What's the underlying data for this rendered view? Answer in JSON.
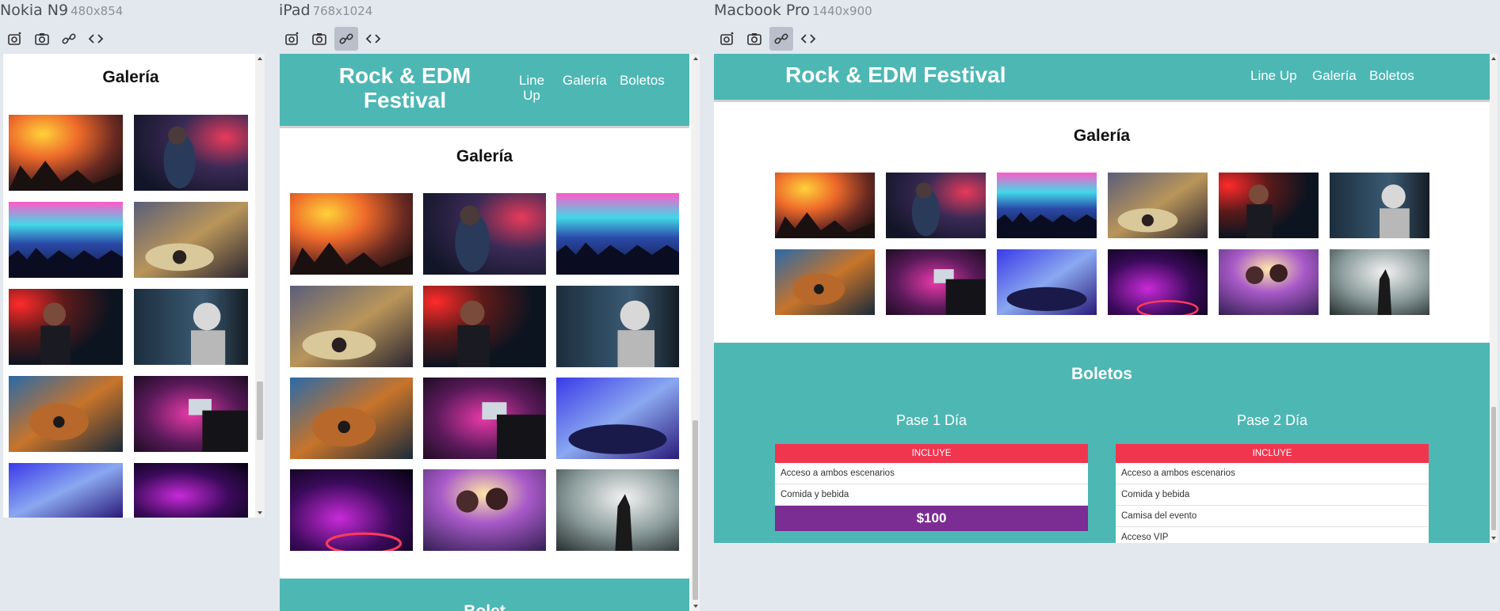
{
  "devices": [
    {
      "name": "Nokia N9",
      "size": "480x854"
    },
    {
      "name": "iPad",
      "size": "768x1024"
    },
    {
      "name": "Macbook Pro",
      "size": "1440x900"
    }
  ],
  "toolbar_icons": [
    "camera-settings-icon",
    "camera-icon",
    "link-icon",
    "code-icon"
  ],
  "site": {
    "title": "Rock & EDM Festival",
    "title_line1": "Rock & EDM",
    "title_line2": "Festival",
    "nav": {
      "lineup": "Line Up",
      "lineup_line1": "Line",
      "lineup_line2": "Up",
      "galeria": "Galería",
      "boletos": "Boletos"
    }
  },
  "gallery": {
    "title": "Galería",
    "photos": [
      "concert-crowd-orange",
      "singer-red-stage",
      "crowd-lasers",
      "dj-turntable",
      "guitarist-red-light",
      "dj-white-cap",
      "guitar-closeup",
      "dj-laptop-neon",
      "dj-mixer-blue",
      "turntable-purple",
      "duo-performers",
      "singer-smoke"
    ]
  },
  "tickets": {
    "title": "Boletos",
    "next_title_partial": "Bolet",
    "includes_label": "INCLUYE",
    "passes": [
      {
        "name": "Pase 1 Día",
        "items": [
          "Acceso a ambos escenarios",
          "Comida y bebida"
        ],
        "price": "$100"
      },
      {
        "name": "Pase 2 Día",
        "items": [
          "Acceso a ambos escenarios",
          "Comida y bebida",
          "Camisa del evento",
          "Acceso VIP"
        ]
      }
    ]
  },
  "colors": {
    "teal": "#4db7b4",
    "ticket_header": "#f0364f",
    "price_bar": "#7b2d94",
    "background": "#e3e7ee"
  }
}
